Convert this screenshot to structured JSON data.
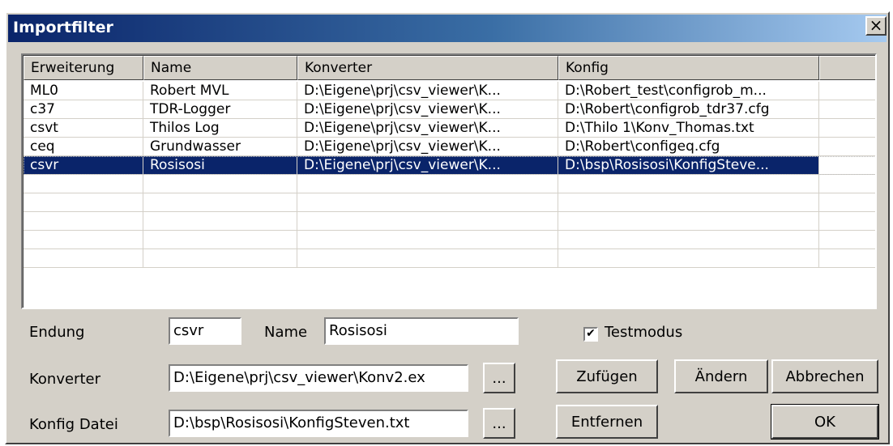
{
  "window": {
    "title": "Importfilter",
    "close_label": "×"
  },
  "list": {
    "columns": [
      "Erweiterung",
      "Name",
      "Konverter",
      "Konfig",
      ""
    ],
    "rows": [
      [
        "ML0",
        "Robert MVL",
        "D:\\Eigene\\prj\\csv_viewer\\K...",
        "D:\\Robert_test\\configrob_m..."
      ],
      [
        "c37",
        "TDR-Logger",
        "D:\\Eigene\\prj\\csv_viewer\\K...",
        "D:\\Robert\\configrob_tdr37.cfg"
      ],
      [
        "csvt",
        "Thilos Log",
        "D:\\Eigene\\prj\\csv_viewer\\K...",
        "D:\\Thilo 1\\Konv_Thomas.txt"
      ],
      [
        "ceq",
        "Grundwasser",
        "D:\\Eigene\\prj\\csv_viewer\\K...",
        "D:\\Robert\\configeq.cfg"
      ],
      [
        "csvr",
        "Rosisosi",
        "D:\\Eigene\\prj\\csv_viewer\\K...",
        "D:\\bsp\\Rosisosi\\KonfigSteve..."
      ]
    ],
    "selected_row": 4,
    "empty_rows": 5
  },
  "form": {
    "endung_label": "Endung",
    "endung_value": "csvr",
    "name_label": "Name",
    "name_value": "Rosisosi",
    "testmodus_label": "Testmodus",
    "testmodus_checked": true,
    "konverter_label": "Konverter",
    "konverter_value": "D:\\Eigene\\prj\\csv_viewer\\Konv2.ex",
    "konfig_label": "Konfig Datei",
    "konfig_value": "D:\\bsp\\Rosisosi\\KonfigSteven.txt",
    "browse_label": "..."
  },
  "buttons": {
    "zufuegen": "Zufügen",
    "aendern": "Ändern",
    "abbrechen": "Abbrechen",
    "entfernen": "Entfernen",
    "ok": "OK"
  },
  "colors": {
    "selection": "#0a246a",
    "face": "#d4d0c8"
  }
}
